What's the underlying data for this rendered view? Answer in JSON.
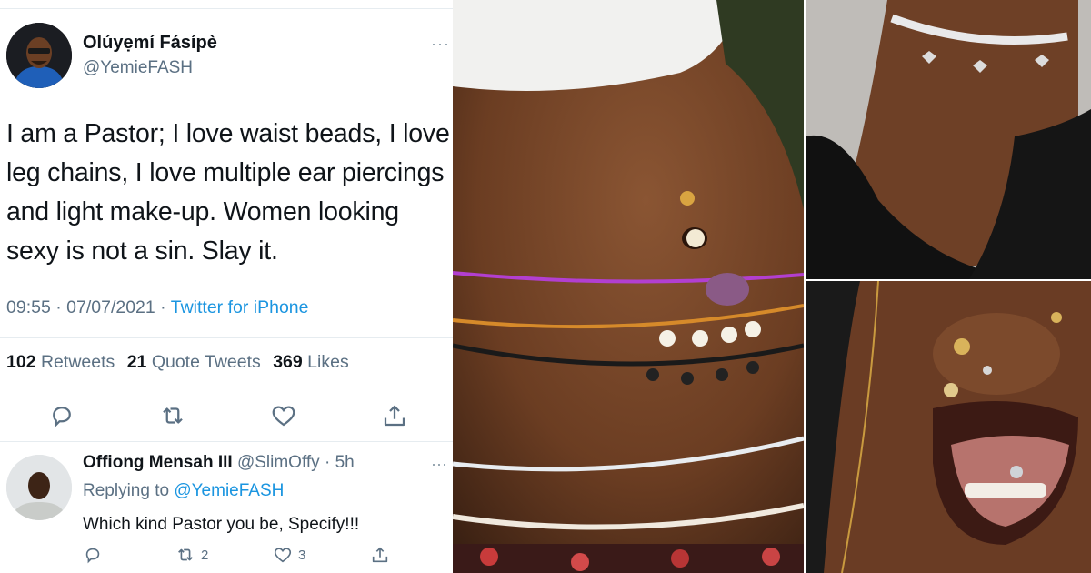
{
  "tweet": {
    "author_name": "Olúyẹmí Fásípè",
    "author_handle": "@YemieFASH",
    "more_label": "···",
    "text_lines": [
      "I am a Pastor; I love waist beads, I love",
      "leg chains, I love multiple ear piercings",
      "and light make-up. Women looking",
      "sexy is not a sin. Slay it."
    ],
    "time": "09:55",
    "separator1": " · ",
    "date": "07/07/2021",
    "separator2": " · ",
    "source": "Twitter for iPhone",
    "stats": {
      "retweets_count": "102",
      "retweets_label": "Retweets",
      "quotes_count": "21",
      "quotes_label": "Quote Tweets",
      "likes_count": "369",
      "likes_label": "Likes"
    },
    "actions": [
      "reply-icon",
      "retweet-icon",
      "like-icon",
      "share-icon"
    ]
  },
  "reply": {
    "author_name": "Offiong Mensah III",
    "author_handle": "@SlimOffy",
    "separator": " · ",
    "time_ago": "5h",
    "more_label": "···",
    "replying_prefix": "Replying to",
    "replying_mention": "@YemieFASH",
    "text": "Which kind Pastor you be, Specify!!!",
    "retweet_count": "2",
    "like_count": "3"
  },
  "colors": {
    "text_primary": "#0f1419",
    "text_secondary": "#5b7083",
    "link": "#1b95e0",
    "divider": "#e6ecf0",
    "skin_dark": "#5a3520",
    "skin_mid": "#8a5533"
  }
}
